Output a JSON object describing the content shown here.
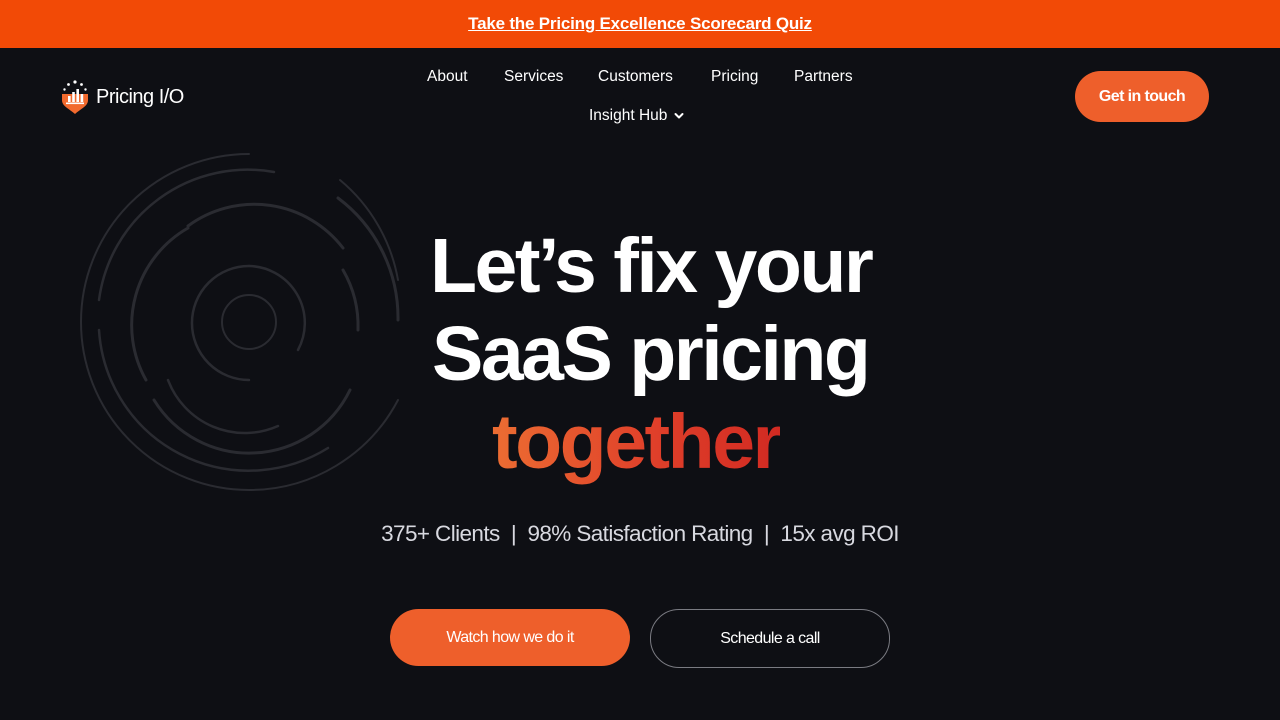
{
  "banner": {
    "link_text": "Take the Pricing Excellence Scorecard Quiz"
  },
  "header": {
    "logo_text": "Pricing I/O",
    "nav": {
      "about": "About",
      "services": "Services",
      "customers": "Customers",
      "pricing": "Pricing",
      "partners": "Partners",
      "insight_hub": "Insight Hub"
    },
    "cta_label": "Get in touch"
  },
  "hero": {
    "headline_line1": "Let’s fix your",
    "headline_line2": "SaaS pricing",
    "headline_accent": "together",
    "stats": "375+ Clients  |  98% Satisfaction Rating  |  15x avg ROI",
    "primary_button": "Watch how we do it",
    "secondary_button": "Schedule a call"
  },
  "colors": {
    "background": "#0e0f14",
    "banner": "#f24a06",
    "accent": "#ee5f2b",
    "accent_gradient_end": "#d12a22"
  },
  "icons": {
    "logo": "pricing-io-logo-icon",
    "dropdown": "chevron-down-icon",
    "decoration": "concentric-rings-graphic"
  }
}
